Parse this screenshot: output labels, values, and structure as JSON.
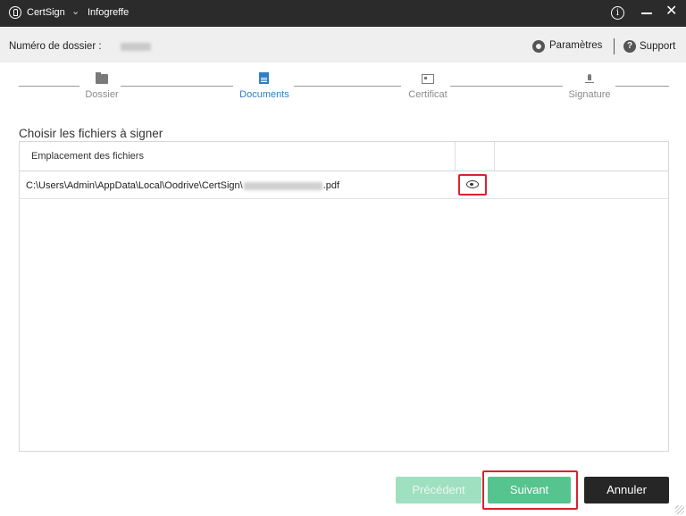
{
  "titlebar": {
    "app_name": "CertSign",
    "caret": "⌄",
    "document_name": "Infogreffe",
    "info_glyph": "i",
    "close_glyph": "✕"
  },
  "header": {
    "dossier_label": "Numéro de dossier :",
    "params_label": "Paramètres",
    "help_glyph": "?",
    "support_label": "Support"
  },
  "steps": [
    {
      "label": "Dossier",
      "icon": "folder-icon",
      "active": false
    },
    {
      "label": "Documents",
      "icon": "document-icon",
      "active": true
    },
    {
      "label": "Certificat",
      "icon": "certificate-icon",
      "active": false
    },
    {
      "label": "Signature",
      "icon": "signature-icon",
      "active": false
    }
  ],
  "section_title": "Choisir les fichiers à signer",
  "table": {
    "columns": [
      "Emplacement des fichiers",
      "",
      ""
    ],
    "rows": [
      {
        "path_prefix": "C:\\Users\\Admin\\AppData\\Local\\Oodrive\\CertSign\\",
        "path_suffix": ".pdf",
        "action_icon": "eye-icon"
      }
    ]
  },
  "buttons": {
    "previous": "Précédent",
    "next": "Suivant",
    "cancel": "Annuler"
  },
  "colors": {
    "titlebar_bg": "#2b2b2b",
    "accent_blue": "#2e7fc6",
    "next_green": "#56c48f",
    "prev_green_disabled": "#9ee0bf",
    "highlight_red": "#d9232d",
    "cancel_dark": "#262626"
  }
}
